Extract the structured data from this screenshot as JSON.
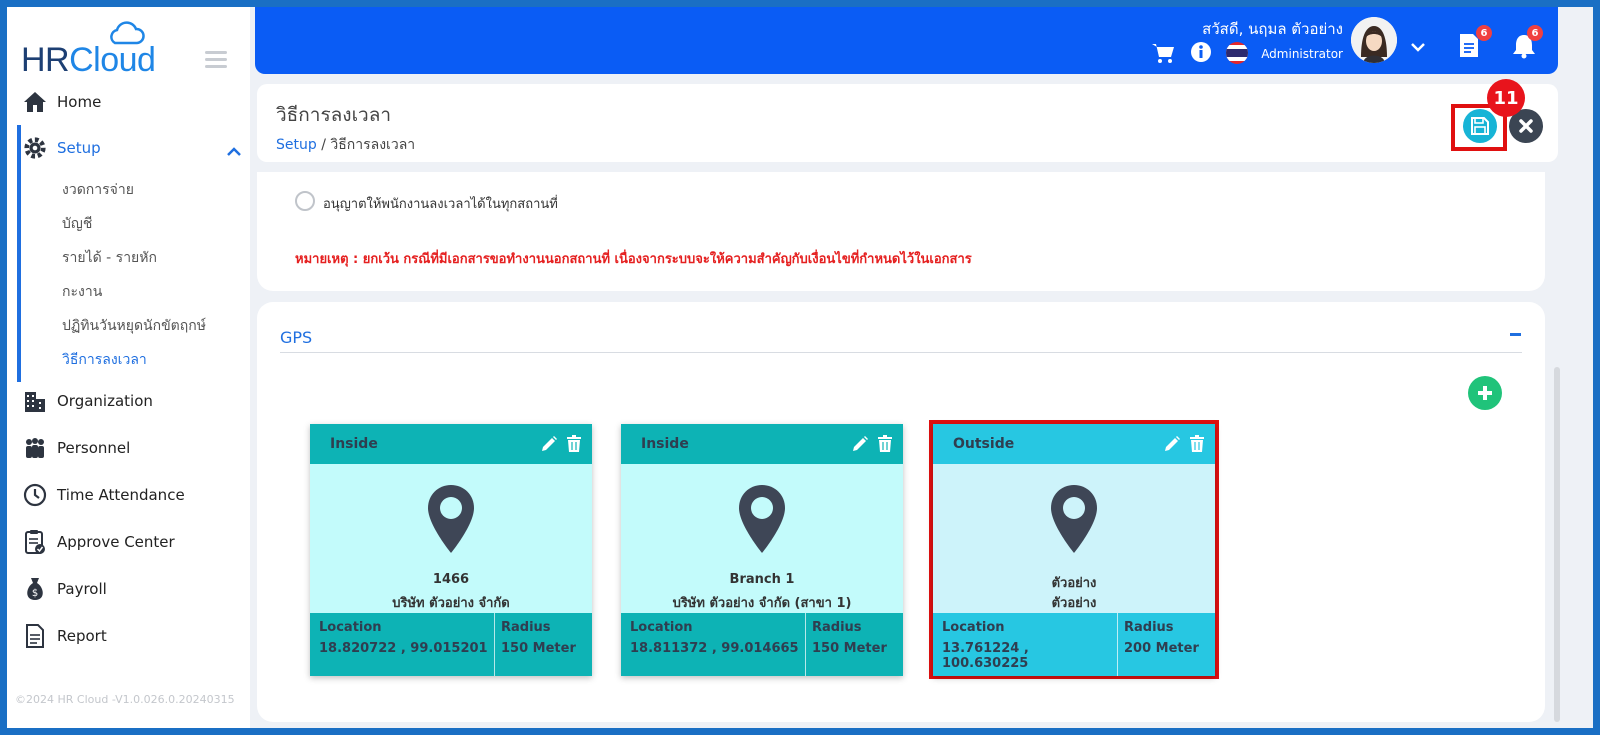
{
  "app": {
    "logo_hr": "HR",
    "logo_cloud": "Cloud",
    "version": "©2024 HR Cloud -V1.0.026.0.20240315"
  },
  "sidebar": {
    "items": [
      {
        "label": "Home",
        "icon": "home-icon"
      },
      {
        "label": "Setup",
        "icon": "gear-icon"
      },
      {
        "label": "Organization",
        "icon": "building-icon"
      },
      {
        "label": "Personnel",
        "icon": "people-icon"
      },
      {
        "label": "Time Attendance",
        "icon": "clock-icon"
      },
      {
        "label": "Approve Center",
        "icon": "clipboard-icon"
      },
      {
        "label": "Payroll",
        "icon": "money-bag-icon"
      },
      {
        "label": "Report",
        "icon": "document-icon"
      }
    ],
    "setup_sub": [
      "งวดการจ่าย",
      "บัญชี",
      "รายได้ - รายหัก",
      "กะงาน",
      "ปฏิทินวันหยุดนักขัตฤกษ์",
      "วิธีการลงเวลา"
    ]
  },
  "header": {
    "greeting": "สวัสดี, นฤมล ตัวอย่าง",
    "role": "Administrator",
    "doc_badge": "6",
    "bell_badge": "6"
  },
  "page": {
    "title": "วิธีการลงเวลา",
    "breadcrumb_root": "Setup",
    "breadcrumb_sep": "/",
    "breadcrumb_current": "วิธีการลงเวลา",
    "step_number": "11"
  },
  "options": {
    "radio_label": "อนุญาตให้พนักงานลงเวลาได้ในทุกสถานที่",
    "note": "หมายเหตุ : ยกเว้น กรณีที่มีเอกสารขอทำงานนอกสถานที่ เนื่องจากระบบจะให้ความสำคัญกับเงื่อนไขที่กำหนดไว้ในเอกสาร"
  },
  "gps": {
    "title": "GPS",
    "location_label": "Location",
    "radius_label": "Radius",
    "cards": [
      {
        "type": "Inside",
        "name": "1466",
        "company": "บริษัท ตัวอย่าง จำกัด",
        "location": "18.820722 , 99.015201",
        "radius": "150 Meter"
      },
      {
        "type": "Inside",
        "name": "Branch 1",
        "company": "บริษัท ตัวอย่าง จำกัด (สาขา 1)",
        "location": "18.811372 , 99.014665",
        "radius": "150 Meter"
      },
      {
        "type": "Outside",
        "name": "ตัวอย่าง",
        "company": "ตัวอย่าง",
        "location": "13.761224 , 100.630225",
        "radius": "200 Meter"
      }
    ]
  },
  "colors": {
    "primary": "#0a5cf5",
    "inside": "#0db3b5",
    "outside": "#27c7e2",
    "highlight": "#e01010"
  }
}
